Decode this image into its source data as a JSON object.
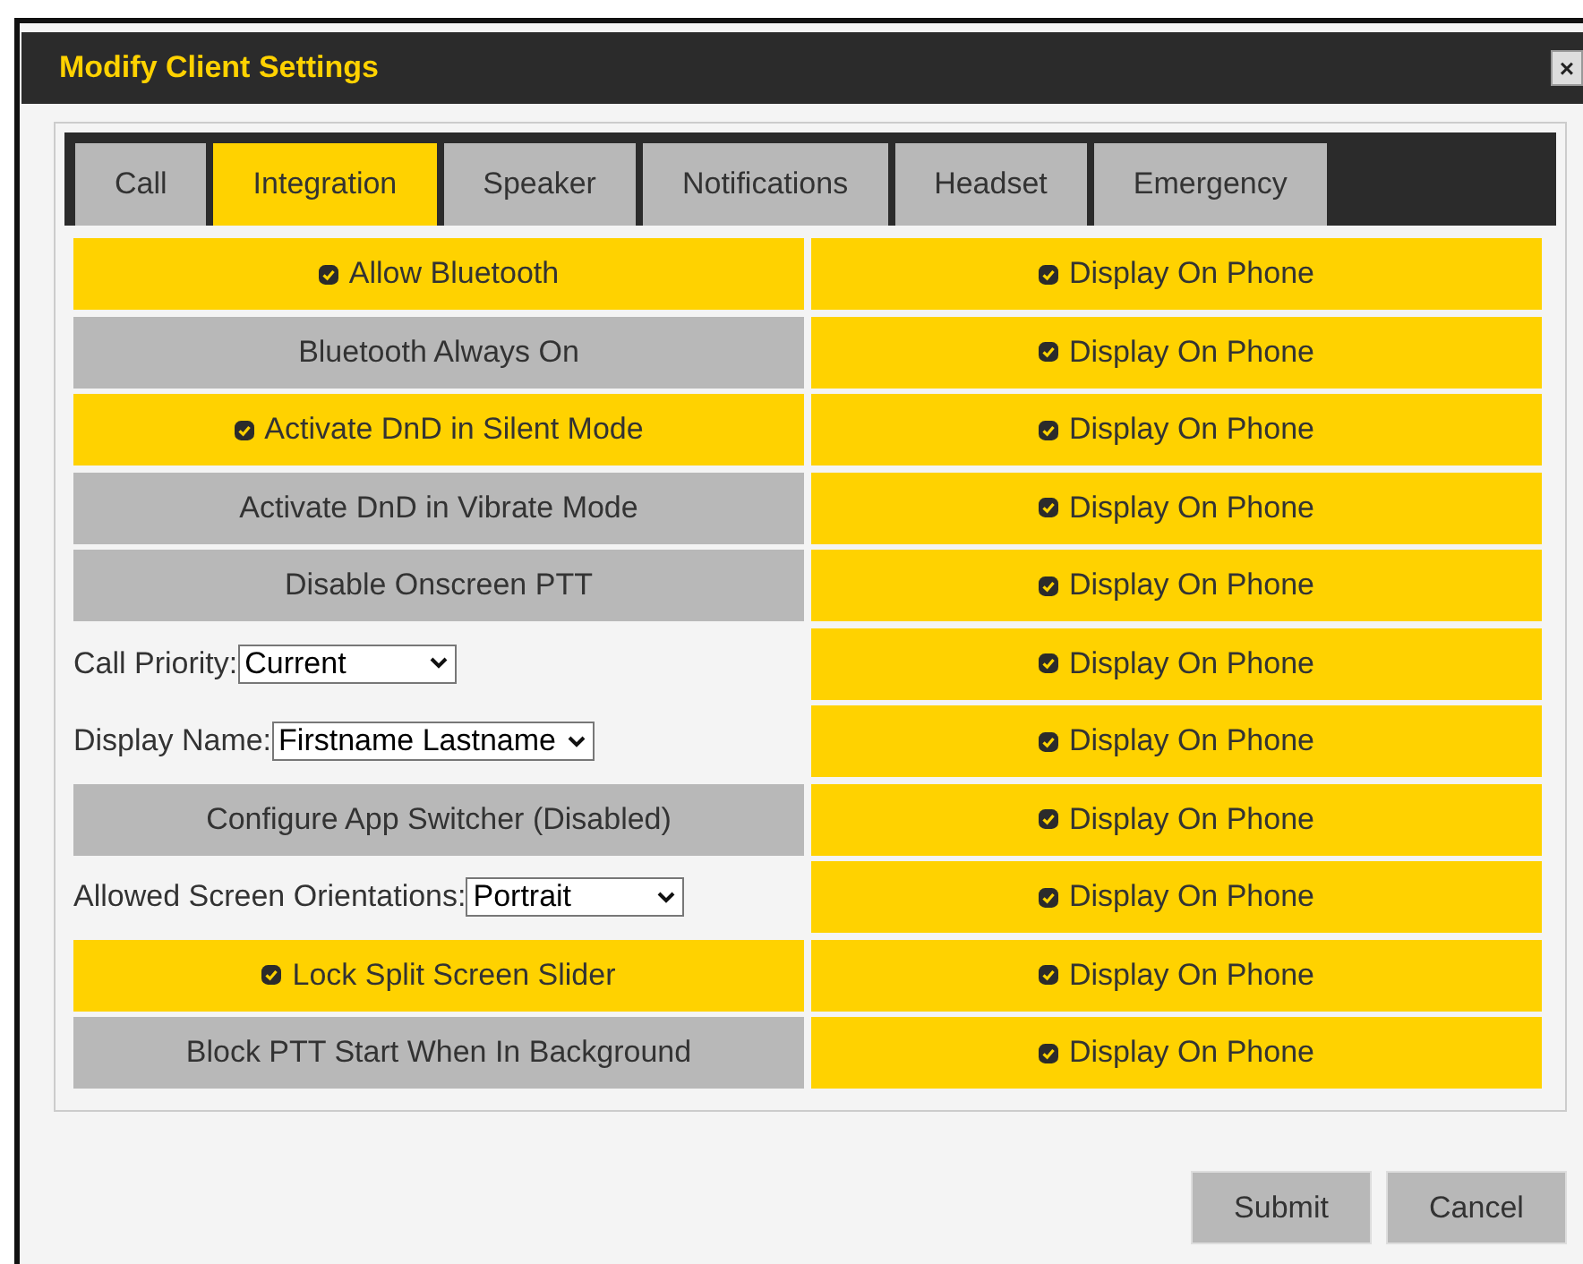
{
  "dialog": {
    "title": "Modify Client Settings",
    "close": "×"
  },
  "tabs": [
    {
      "label": "Call",
      "selected": false
    },
    {
      "label": "Integration",
      "selected": true
    },
    {
      "label": "Speaker",
      "selected": false
    },
    {
      "label": "Notifications",
      "selected": false
    },
    {
      "label": "Headset",
      "selected": false
    },
    {
      "label": "Emergency",
      "selected": false
    }
  ],
  "settings": [
    {
      "kind": "toggle",
      "label": "Allow Bluetooth",
      "checked": true,
      "display": {
        "label": "Display On Phone",
        "checked": true
      }
    },
    {
      "kind": "toggle",
      "label": "Bluetooth Always On",
      "checked": false,
      "display": {
        "label": "Display On Phone",
        "checked": true
      }
    },
    {
      "kind": "toggle",
      "label": "Activate DnD in Silent Mode",
      "checked": true,
      "display": {
        "label": "Display On Phone",
        "checked": true
      }
    },
    {
      "kind": "toggle",
      "label": "Activate DnD in Vibrate Mode",
      "checked": false,
      "display": {
        "label": "Display On Phone",
        "checked": true
      }
    },
    {
      "kind": "toggle",
      "label": "Disable Onscreen PTT",
      "checked": false,
      "display": {
        "label": "Display On Phone",
        "checked": true
      }
    },
    {
      "kind": "select",
      "label": "Call Priority:",
      "value": "Current",
      "display": {
        "label": "Display On Phone",
        "checked": true
      }
    },
    {
      "kind": "select",
      "label": "Display Name:",
      "value": "Firstname Lastname",
      "display": {
        "label": "Display On Phone",
        "checked": true
      }
    },
    {
      "kind": "toggle",
      "label": "Configure App Switcher (Disabled)",
      "checked": false,
      "display": {
        "label": "Display On Phone",
        "checked": true
      }
    },
    {
      "kind": "select",
      "label": "Allowed Screen Orientations:",
      "value": "Portrait",
      "display": {
        "label": "Display On Phone",
        "checked": true
      }
    },
    {
      "kind": "toggle",
      "label": "Lock Split Screen Slider",
      "checked": true,
      "display": {
        "label": "Display On Phone",
        "checked": true
      }
    },
    {
      "kind": "toggle",
      "label": "Block PTT Start When In Background",
      "checked": false,
      "display": {
        "label": "Display On Phone",
        "checked": true
      }
    }
  ],
  "buttons": [
    "Submit",
    "Cancel"
  ]
}
